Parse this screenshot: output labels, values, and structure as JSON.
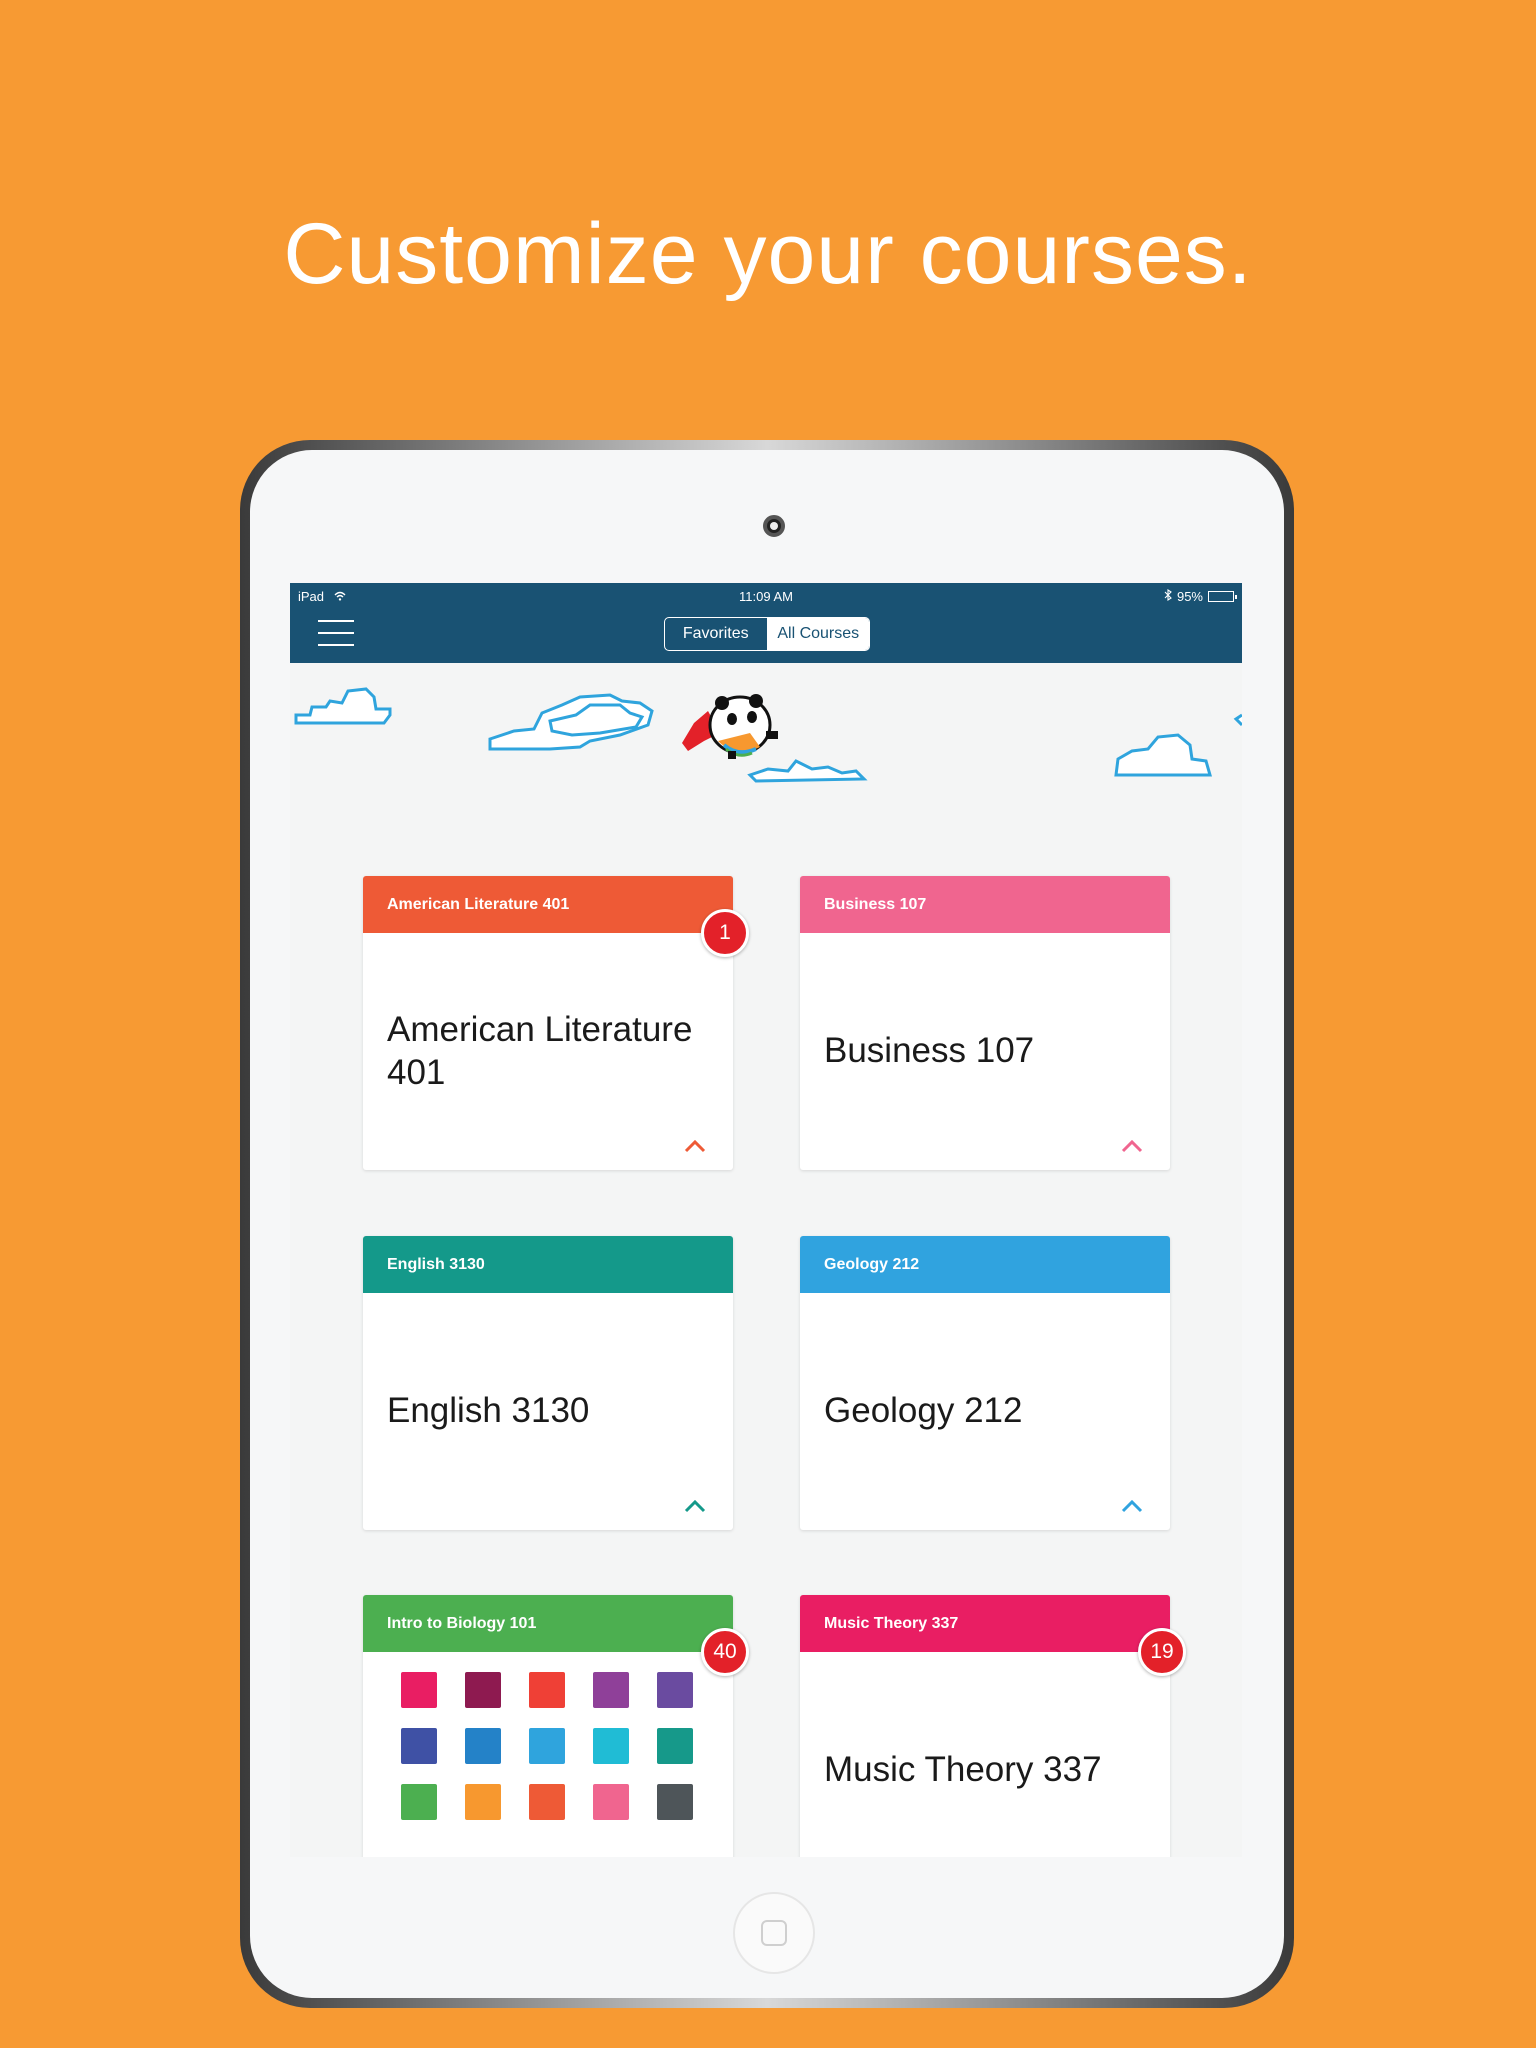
{
  "headline": "Customize your courses.",
  "status_bar": {
    "carrier": "iPad",
    "time": "11:09 AM",
    "battery": "95%",
    "battery_level": 0.95
  },
  "nav": {
    "segments": [
      "Favorites",
      "All Courses"
    ],
    "selected": "All Courses"
  },
  "courses": [
    {
      "header": "American Literature 401",
      "title": "American Literature 401",
      "color": "#ee5a36",
      "badge": "1"
    },
    {
      "header": "Business 107",
      "title": "Business 107",
      "color": "#f0658f",
      "badge": ""
    },
    {
      "header": "English 3130",
      "title": "English 3130",
      "color": "#14998a",
      "badge": ""
    },
    {
      "header": "Geology 212",
      "title": "Geology 212",
      "color": "#30a3df",
      "badge": ""
    },
    {
      "header": "Intro to Biology 101",
      "title": "",
      "color": "#4caf50",
      "badge": "40"
    },
    {
      "header": "Music Theory 337",
      "title": "Music Theory 337",
      "color": "#e91e63",
      "badge": "19"
    }
  ],
  "color_picker": [
    "#e91e63",
    "#8e1a50",
    "#ef4036",
    "#8f4099",
    "#6a4ba0",
    "#3f51a5",
    "#2482c8",
    "#2fa4dd",
    "#20bcd5",
    "#16998a",
    "#4caf50",
    "#f7982f",
    "#ee5a36",
    "#f0658f",
    "#4e5559"
  ]
}
